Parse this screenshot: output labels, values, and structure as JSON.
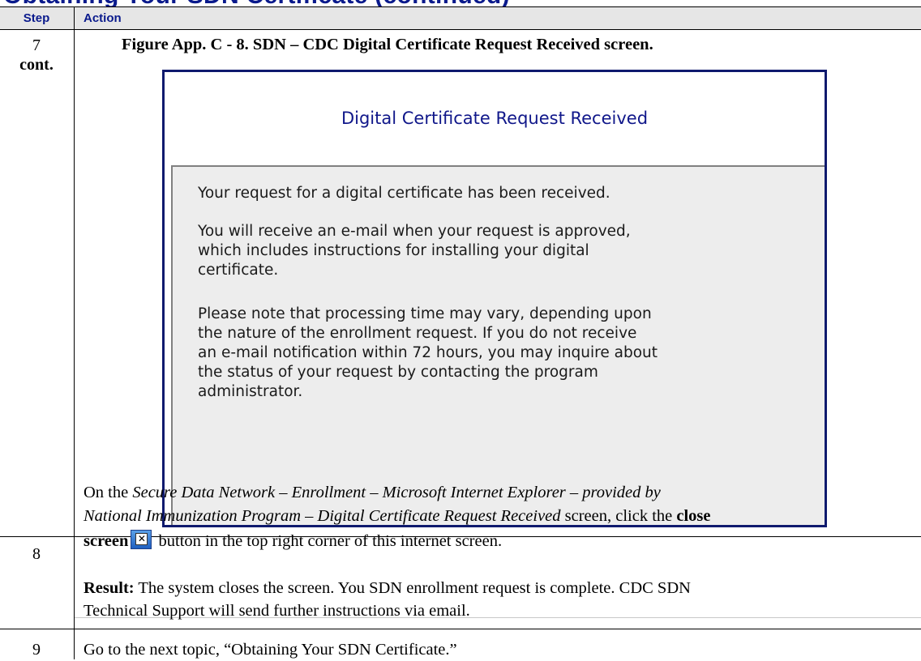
{
  "page": {
    "section_heading": "Obtaining Your SDN Certificate (continued)"
  },
  "table": {
    "headers": {
      "step": "Step",
      "action": "Action"
    },
    "rows": [
      {
        "step": "7",
        "step_note": "cont.",
        "figure_caption": "Figure App. C - 8. SDN – CDC Digital Certificate Request Received screen.",
        "screenshot": {
          "title": "Digital Certificate Request Received",
          "paragraphs": [
            "Your request for a digital certificate has been received.",
            "You will receive an e-mail when your request is approved,\nwhich includes instructions for installing your digital\ncertificate.",
            "Please note that processing time may vary, depending upon\nthe nature of the enrollment request. If you do not receive\nan e-mail notification within 72 hours, you may inquire about\nthe status of your request by contacting the program\nadministrator."
          ]
        }
      },
      {
        "step": "8",
        "action": {
          "line1_prefix": "On the ",
          "line1_italic": "Secure Data Network – Enrollment – Microsoft Internet Explorer – provided by",
          "line2_italic": "National Immunization Program – Digital Certificate Request Received",
          "line2_suffix": " screen, click the ",
          "line2_bold": "close",
          "line3_bold": "screen",
          "line3_suffix": " button in the top right corner of this internet screen.",
          "close_icon": "close-window-icon"
        },
        "result": {
          "label": "Result:",
          "line1": " The system closes the screen. You SDN enrollment request is complete. CDC SDN",
          "line2": "Technical Support will send further instructions via email."
        }
      },
      {
        "step": "9",
        "action": "Go to the next topic, “Obtaining Your SDN Certificate.”"
      }
    ]
  }
}
